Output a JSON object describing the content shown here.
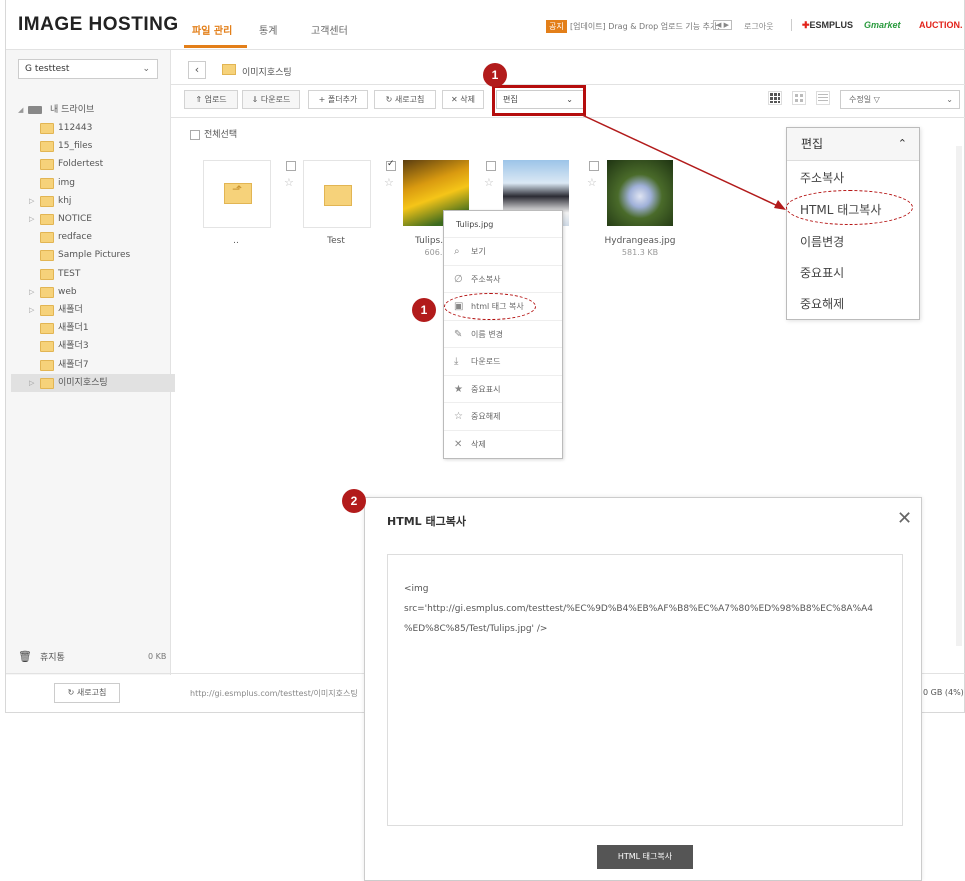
{
  "header": {
    "logo": "IMAGE HOSTING",
    "nav": [
      "파일 관리",
      "통계",
      "고객센터"
    ],
    "notice_badge": "공지",
    "notice_text": "[업데이트] Drag & Drop 업로드 기능 추가.",
    "notice_nav": "◀ ▶",
    "logout": "로그아웃",
    "brands": [
      "ESMPLUS",
      "Gmarket",
      "AUCTION."
    ],
    "colors": {
      "accent": "#e37f19",
      "gmarket": "#2a9b3e",
      "auction": "#e2231a",
      "annotation": "#b21b1b"
    }
  },
  "sidebar": {
    "account": "G testtest",
    "drive_label": "내 드라이브",
    "folders": [
      "112443",
      "15_files",
      "Foldertest",
      "img",
      "khj",
      "NOTICE",
      "redface",
      "Sample Pictures",
      "TEST",
      "web",
      "새폴더",
      "새폴더1",
      "새폴더3",
      "새폴더7",
      "이미지호스팅"
    ],
    "trash_label": "휴지통",
    "trash_size": "0 KB",
    "refresh_label": "새로고침"
  },
  "toolbar": {
    "breadcrumb": "이미지호스팅",
    "buttons": [
      "업로드",
      "다운로드",
      "폴더추가",
      "새로고침",
      "삭제"
    ],
    "button_icons": [
      "⇑",
      "⇓",
      "+",
      "↻",
      "✕"
    ],
    "edit_select": "편집",
    "sort_select": "수정일 ▽",
    "select_all": "전체선택"
  },
  "files": [
    {
      "name": "..",
      "size": ""
    },
    {
      "name": "Test",
      "size": ""
    },
    {
      "name": "Tulips.jpg",
      "size": "606.3"
    },
    {
      "name": "",
      "size": ""
    },
    {
      "name": "Hydrangeas.jpg",
      "size": "581.3 KB"
    }
  ],
  "context_menu": {
    "title": "Tulips.jpg",
    "items": [
      {
        "label": "보기",
        "icon": "search-icon",
        "glyph": "⌕"
      },
      {
        "label": "주소복사",
        "icon": "link-icon",
        "glyph": "∅"
      },
      {
        "label": "html 태그 복사",
        "icon": "code-icon",
        "glyph": "▣"
      },
      {
        "label": "이름 변경",
        "icon": "pencil-icon",
        "glyph": "✎"
      },
      {
        "label": "다운로드",
        "icon": "download-icon",
        "glyph": "⤓"
      },
      {
        "label": "중요표시",
        "icon": "star-filled-icon",
        "glyph": "★"
      },
      {
        "label": "중요해제",
        "icon": "star-outline-icon",
        "glyph": "☆"
      },
      {
        "label": "삭제",
        "icon": "close-icon",
        "glyph": "✕"
      }
    ]
  },
  "edit_dropdown": {
    "title": "편집",
    "options": [
      "주소복사",
      "HTML 태그복사",
      "이름변경",
      "중요표시",
      "중요해제"
    ]
  },
  "annotations": {
    "badge1": "1",
    "badge2": "2"
  },
  "modal": {
    "title": "HTML 태그복사",
    "code_line1": "<img",
    "code_line2": "src='http://gi.esmplus.com/testtest/%EC%9D%B4%EB%AF%B8%EC%A7%80%ED%98%B8%EC%8A%A4",
    "code_line3": "%ED%8C%85/Test/Tulips.jpg' />",
    "button": "HTML 태그복사"
  },
  "status": {
    "url": "http://gi.esmplus.com/testtest/이미지호스팅",
    "usage": "0 GB (4%)"
  }
}
